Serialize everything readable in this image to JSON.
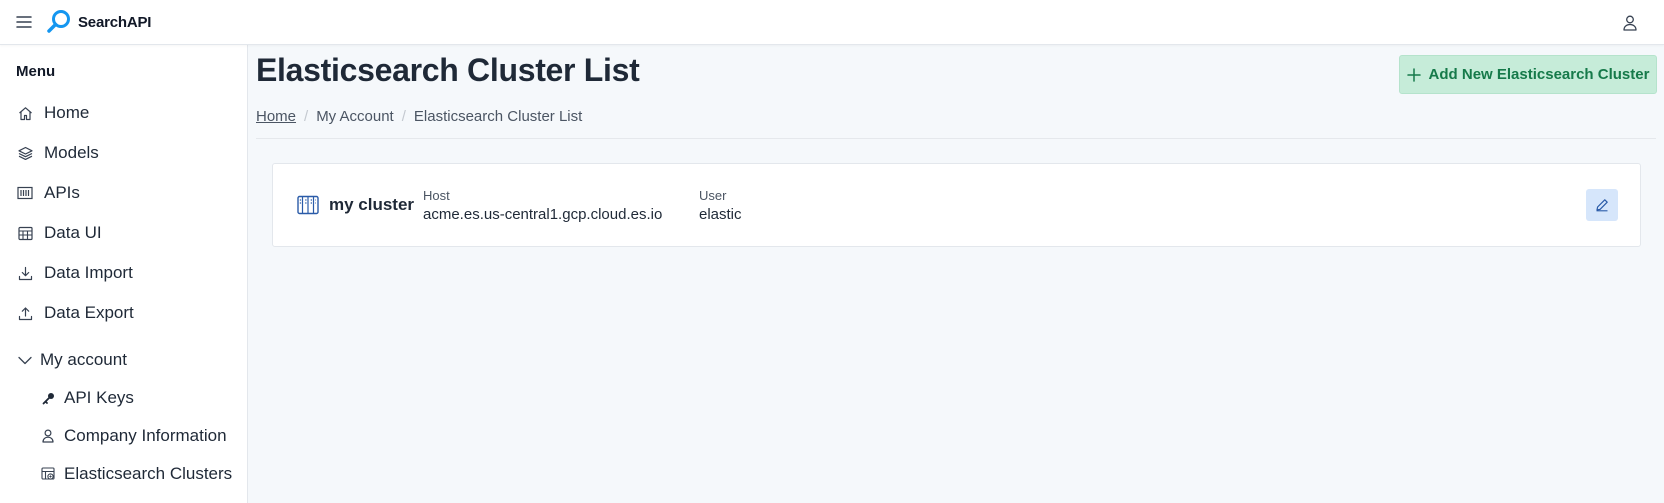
{
  "app": {
    "brand": "SearchAPI"
  },
  "icons": {
    "menu": "hamburger-icon",
    "logo": "magnifier-logo",
    "user": "user-icon"
  },
  "colors": {
    "logo": "#1496f0",
    "add_button_bg": "#c6ecd9",
    "add_button_text": "#167a4a",
    "edit_button_bg": "#d6e6fb",
    "accent_icon": "#2a5ba8"
  },
  "sidebar": {
    "title": "Menu",
    "items": [
      {
        "label": "Home",
        "icon": "home-icon"
      },
      {
        "label": "Models",
        "icon": "layers-icon"
      },
      {
        "label": "APIs",
        "icon": "api-icon"
      },
      {
        "label": "Data UI",
        "icon": "table-icon"
      },
      {
        "label": "Data Import",
        "icon": "download-icon"
      },
      {
        "label": "Data Export",
        "icon": "upload-icon"
      }
    ],
    "group": {
      "label": "My account",
      "icon": "chevron-down-icon",
      "expanded": true,
      "items": [
        {
          "label": "API Keys",
          "icon": "key-icon"
        },
        {
          "label": "Company Information",
          "icon": "person-icon"
        },
        {
          "label": "Elasticsearch Clusters",
          "icon": "cluster-table-icon"
        }
      ]
    }
  },
  "main": {
    "title": "Elasticsearch Cluster List",
    "add_button_label": "Add New Elasticsearch Cluster",
    "breadcrumb": [
      "Home",
      "My Account",
      "Elasticsearch Cluster List"
    ],
    "clusters": [
      {
        "name": "my cluster",
        "host_label": "Host",
        "host": "acme.es.us-central1.gcp.cloud.es.io",
        "user_label": "User",
        "user": "elastic",
        "icon": "server-icon",
        "edit_icon": "pencil-icon"
      }
    ]
  }
}
